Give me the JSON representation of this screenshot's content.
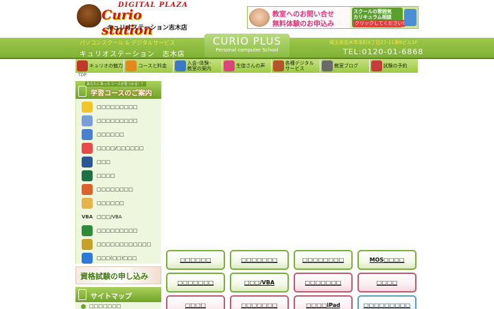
{
  "header": {
    "logo": {
      "top_text": "DIGITAL PLAZA",
      "brand": "Curio station",
      "store": "キュリオステーション志木店"
    },
    "banner": {
      "line1": "教室へのお問い合せ",
      "line2": "無料体験のお申込み",
      "side1": "スクールの雰囲気",
      "side2": "カリキュラム相談",
      "side3": "クリックしてください!"
    }
  },
  "band": {
    "tagline": "パソコンスクール & デジタルサービス",
    "store_name": "キュリオステーション　志木店",
    "curio_title": "CURIO PLUS",
    "curio_sub": "Personal computer School",
    "address": "埼玉県志木市本町6丁目27-11第6ビル1F",
    "tel": "TEL:0120-01-6868"
  },
  "nav": {
    "items": [
      {
        "label": "キュリオの魅力",
        "color": "#c0392b"
      },
      {
        "label": "コースと料金",
        "color": "#e08a1e"
      },
      {
        "label": "入会･体験･\n教室の案内",
        "color": "#3a78c2"
      },
      {
        "label": "生徒さんの声",
        "color": "#d9477a"
      },
      {
        "label": "各種デジタル\nサービス",
        "color": "#b5542a"
      },
      {
        "label": "教室ブログ",
        "color": "#6a6a6a"
      },
      {
        "label": "試験の予約",
        "color": "#c43c3c"
      }
    ]
  },
  "breadcrumb": "TOP",
  "sidebar": {
    "sub": "あなたにあったコースが見つかる！？",
    "title": "学習コースのご案内",
    "courses": [
      {
        "label": "□□□□□□□□□",
        "color": "#f2c62a"
      },
      {
        "label": "□□□□□□□□□",
        "color": "#7a9ed8"
      },
      {
        "label": "□□□□□□",
        "color": "#4a7fd0"
      },
      {
        "label": "□□□□/□□□□□□",
        "color": "#e64b4b"
      },
      {
        "label": "□□□",
        "color": "#2b5797"
      },
      {
        "label": "□□□□",
        "color": "#1e7145"
      },
      {
        "label": "□□□□□□□□",
        "color": "#d9632a"
      },
      {
        "label": "□□□□□□",
        "color": "#e6b54a"
      },
      {
        "label": "□□□/VBA",
        "color": "#3a3a3a",
        "prefix": "VBA"
      },
      {
        "label": "□□□□□□□□□",
        "color": "#2f8a3a"
      },
      {
        "label": "□□□□□□□□□□□□",
        "color": "#c7a02a"
      },
      {
        "label": "□□□(□□)□□□",
        "color": "#2f7ad8"
      }
    ],
    "exam_banner": "資格試験の申し込み",
    "sitemap_title": "サイトマップ",
    "sitemap_first": "□□□□□□□"
  },
  "main": {
    "buttons": [
      {
        "label": "□□□□□□",
        "style": "green"
      },
      {
        "label": "□□□□□□□",
        "style": "green"
      },
      {
        "label": "□□□□□□□□",
        "style": "green"
      },
      {
        "label": "MOS□□□□",
        "style": "green"
      },
      {
        "label": "□□□□□□□",
        "style": "green"
      },
      {
        "label": "□□□/VBA",
        "style": "green"
      },
      {
        "label": "□□□□□□□",
        "style": "pink"
      },
      {
        "label": "□□□□",
        "style": "pink"
      },
      {
        "label": "□□□□",
        "style": "pink"
      },
      {
        "label": "□□□□□□□",
        "style": "pink"
      },
      {
        "label": "□□□□iPad",
        "style": "pink"
      },
      {
        "label": "□□□□□□□□□",
        "style": "blue"
      }
    ]
  }
}
